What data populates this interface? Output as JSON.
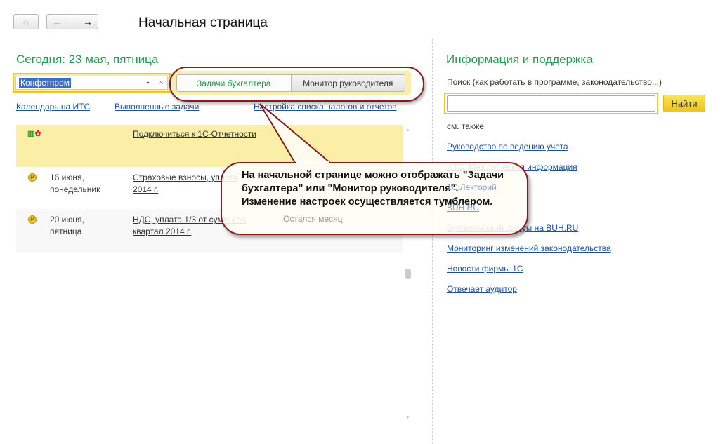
{
  "header": {
    "title": "Начальная страница",
    "home_icon": "home-icon",
    "back_icon": "arrow-left-icon",
    "forward_icon": "arrow-right-icon"
  },
  "left": {
    "today": "Сегодня: 23 мая, пятница",
    "org_value": "Конфетпром",
    "toggle": {
      "option1": "Задачи бухгалтера",
      "option2": "Монитор руководителя"
    },
    "links": [
      "Календарь на ИТС",
      "Выполненные задачи",
      "Настройка списка налогов и отчетов"
    ],
    "tasks": [
      {
        "date": "",
        "weekday": "",
        "text": "Подключиться к 1С-Отчетности",
        "text2": "",
        "status": ""
      },
      {
        "date": "16 июня,",
        "weekday": "понедельник",
        "text": "Страховые взносы, уплата",
        "text2": "2014 г.",
        "status": ""
      },
      {
        "date": "20 июня,",
        "weekday": "пятница",
        "text": "НДС, уплата 1/3 от суммы за",
        "text2": "квартал 2014 г.",
        "status": "Остался месяц"
      }
    ]
  },
  "right": {
    "title": "Информация и поддержка",
    "search_label": "Поиск (как работать в программе, законодательство...)",
    "search_value": "",
    "find_button": "Найти",
    "see_also": "см. также",
    "links": [
      "Руководство по ведению учета",
      "ИТС. Методическая информация",
      "1С:Лекторий",
      "BUH.RU",
      "Бухгалтерский форум на BUH.RU",
      "Мониторинг изменений законодательства",
      "Новости фирмы 1С",
      "Отвечает аудитор"
    ]
  },
  "callout": {
    "text": "На начальной странице можно отображать \"Задачи бухгалтера\" или \"Монитор руководителя\". Изменение настроек осуществляется тумблером."
  },
  "colors": {
    "accent_green": "#1e9e4c",
    "highlight_yellow": "#fbeea6",
    "callout_border": "#8b1a1a",
    "link": "#1c4fa8"
  }
}
